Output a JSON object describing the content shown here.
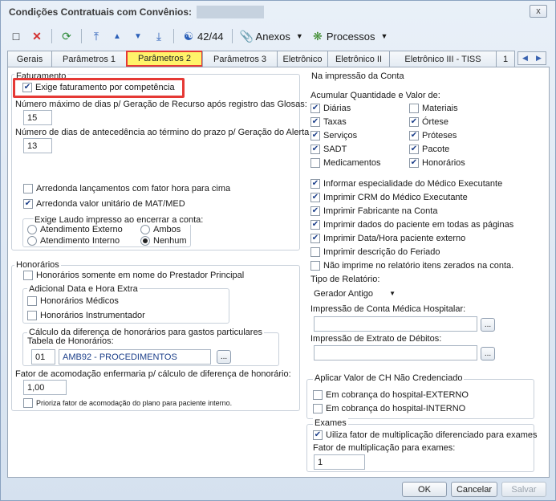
{
  "window": {
    "title": "Condições Contratuais com Convênios:",
    "close_label": "x"
  },
  "toolbar": {
    "page_counter": "42/44",
    "anexos_label": "Anexos",
    "processos_label": "Processos"
  },
  "tabs": [
    {
      "label": "Gerais",
      "active": false
    },
    {
      "label": "Parâmetros 1",
      "active": false
    },
    {
      "label": "Parâmetros 2",
      "active": true
    },
    {
      "label": "Parâmetros 3",
      "active": false
    },
    {
      "label": "Eletrônico",
      "active": false
    },
    {
      "label": "Eletrônico II",
      "active": false
    },
    {
      "label": "Eletrônico III - TISS",
      "active": false
    },
    {
      "label": "1",
      "active": false
    }
  ],
  "faturamento": {
    "group_label": "Faturamento",
    "exige_label": "Exige faturamento por competência",
    "exige_checked": true,
    "max_dias_label": "Número máximo de dias p/ Geração de Recurso após registro das Glosas:",
    "max_dias_value": "15",
    "antecedencia_label": "Número de dias de antecedência ao término do prazo p/ Geração do Alerta",
    "antecedencia_value": "13",
    "arredonda_fator_label": "Arredonda lançamentos com fator hora para cima",
    "arredonda_fator_checked": false,
    "arredonda_mat_label": "Arredonda valor unitário de MAT/MED",
    "arredonda_mat_checked": true,
    "laudo_label": "Exige Laudo impresso ao encerrar a conta:",
    "laudo_options": [
      "Atendimento Externo",
      "Ambos",
      "Atendimento Interno",
      "Nenhum"
    ],
    "laudo_selected": "Nenhum"
  },
  "honorarios": {
    "group_label": "Honorários",
    "somente_label": "Honorários somente em nome do Prestador Principal",
    "somente_checked": false,
    "adicional_label": "Adicional Data e Hora Extra",
    "medicos_label": "Honorários Médicos",
    "medicos_checked": false,
    "instrumentador_label": "Honorários Instrumentador",
    "instrumentador_checked": false,
    "calculo_label": "Cálculo da diferença de honorários para gastos particulares",
    "tabela_label": "Tabela de Honorários:",
    "tabela_code": "01",
    "tabela_name": "AMB92 - PROCEDIMENTOS",
    "fator_label": "Fator de acomodação enfermaria p/ cálculo de diferença de honorário:",
    "fator_value": "1,00",
    "prioriza_label": "Prioriza fator de acomodação do plano para paciente interno.",
    "prioriza_checked": false
  },
  "impressao": {
    "group_label": "Na impressão da Conta",
    "acumular_label": "Acumular Quantidade e Valor de:",
    "acumular_items": [
      {
        "label": "Diárias",
        "checked": true
      },
      {
        "label": "Materiais",
        "checked": false
      },
      {
        "label": "Taxas",
        "checked": true
      },
      {
        "label": "Órtese",
        "checked": true
      },
      {
        "label": "Serviços",
        "checked": true
      },
      {
        "label": "Próteses",
        "checked": true
      },
      {
        "label": "SADT",
        "checked": true
      },
      {
        "label": "Pacote",
        "checked": true
      },
      {
        "label": "Medicamentos",
        "checked": false
      },
      {
        "label": "Honorários",
        "checked": true
      }
    ],
    "options": [
      {
        "label": "Informar especialidade do Médico Executante",
        "checked": true
      },
      {
        "label": "Imprimir CRM do Médico Executante",
        "checked": true
      },
      {
        "label": "Imprimir Fabricante na Conta",
        "checked": true
      },
      {
        "label": "Imprimir dados do paciente em todas as páginas",
        "checked": true
      },
      {
        "label": "Imprimir Data/Hora paciente externo",
        "checked": true
      },
      {
        "label": "Imprimir descrição do Feriado",
        "checked": false
      },
      {
        "label": "Não imprime no relatório itens zerados na conta.",
        "checked": false
      }
    ],
    "tipo_label": "Tipo de Relatório:",
    "tipo_value": "Gerador Antigo",
    "conta_medica_label": "Impressão de Conta Médica Hospitalar:",
    "extrato_label": "Impressão de Extrato de Débitos:"
  },
  "ch": {
    "group_label": "Aplicar Valor de CH Não Credenciado",
    "externo_label": "Em cobrança do hospital-EXTERNO",
    "externo_checked": false,
    "interno_label": "Em cobrança do hospital-INTERNO",
    "interno_checked": false
  },
  "exames": {
    "group_label": "Exames",
    "utiliza_label": "Uiliza fator de multiplicação diferenciado para exames",
    "utiliza_checked": true,
    "fator_label": "Fator de multiplicação para exames:",
    "fator_value": "1"
  },
  "footer": {
    "ok_label": "OK",
    "cancel_label": "Cancelar",
    "save_label": "Salvar"
  },
  "dots_label": "...",
  "colors": {
    "highlight": "#e53935",
    "active_tab": "#fff36a",
    "link_blue": "#1c3f8a"
  }
}
